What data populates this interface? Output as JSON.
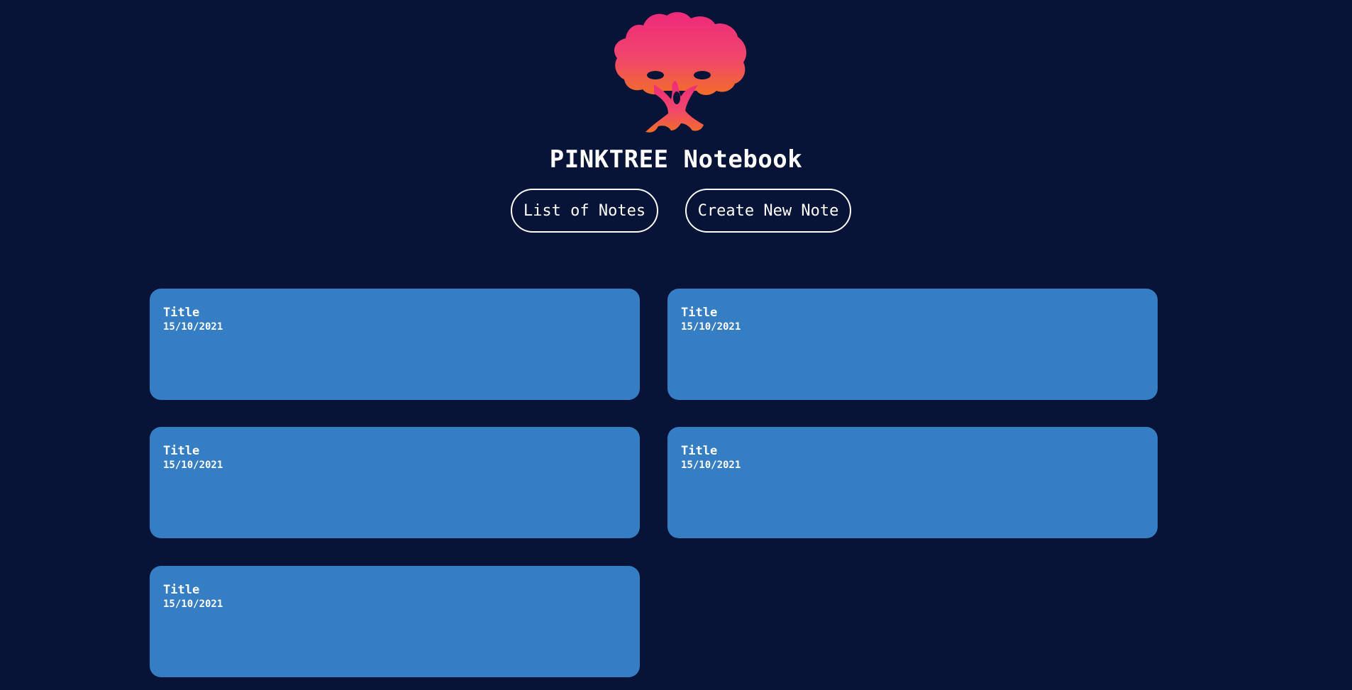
{
  "app": {
    "title": "PINKTREE Notebook",
    "logo_icon": "tree-logo-icon",
    "colors": {
      "background": "#071437",
      "card": "#357ec4",
      "logo_gradient_top": "#ee2a7b",
      "logo_gradient_bottom": "#f26d2a"
    }
  },
  "nav": {
    "list_label": "List of Notes",
    "create_label": "Create New Note"
  },
  "notes": [
    {
      "title": "Title",
      "date": "15/10/2021"
    },
    {
      "title": "Title",
      "date": "15/10/2021"
    },
    {
      "title": "Title",
      "date": "15/10/2021"
    },
    {
      "title": "Title",
      "date": "15/10/2021"
    },
    {
      "title": "Title",
      "date": "15/10/2021"
    }
  ]
}
